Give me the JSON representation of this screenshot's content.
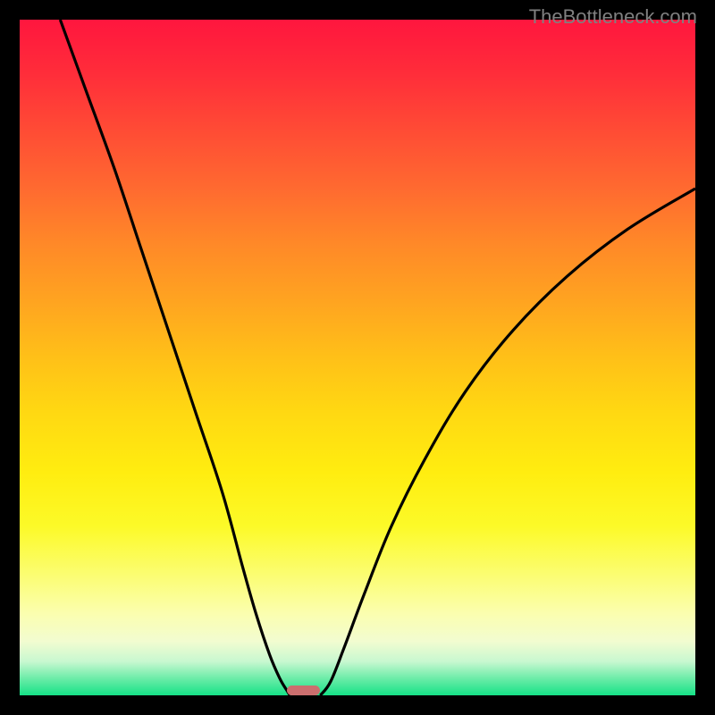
{
  "watermark": "TheBottleneck.com",
  "chart_data": {
    "type": "line",
    "title": "",
    "xlabel": "",
    "ylabel": "",
    "xlim": [
      0,
      100
    ],
    "ylim": [
      0,
      100
    ],
    "series": [
      {
        "name": "left-curve",
        "x": [
          6,
          10,
          14,
          18,
          22,
          26,
          30,
          33,
          35,
          37,
          38.5,
          39.5,
          40
        ],
        "y": [
          100,
          89,
          78,
          66,
          54,
          42,
          30,
          19,
          12,
          6,
          2.5,
          0.8,
          0
        ]
      },
      {
        "name": "right-curve",
        "x": [
          44.5,
          46,
          48,
          51,
          55,
          60,
          66,
          73,
          81,
          90,
          100
        ],
        "y": [
          0,
          2,
          7,
          15,
          25,
          35,
          45,
          54,
          62,
          69,
          75
        ]
      }
    ],
    "marker": {
      "x": 42,
      "y": 0,
      "width": 5,
      "height": 1.5
    },
    "background_gradient": {
      "top": "#ff163e",
      "mid": "#ffd812",
      "bottom": "#16e287"
    }
  }
}
